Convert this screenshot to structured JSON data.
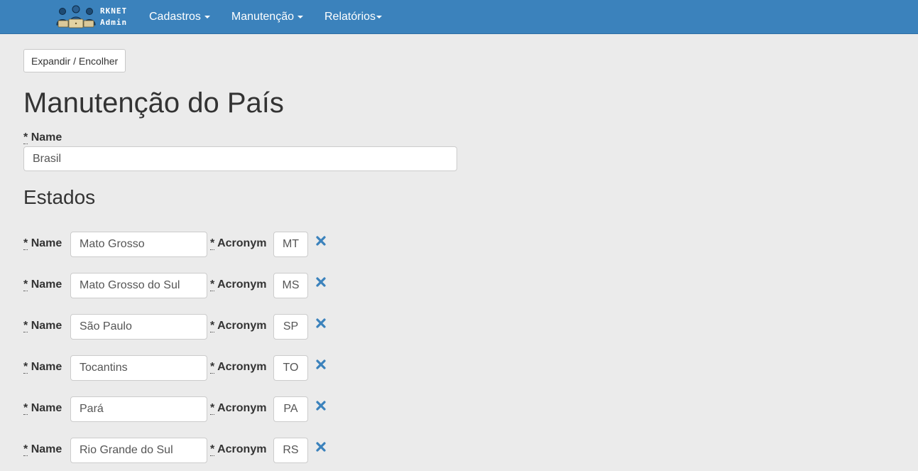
{
  "navbar": {
    "brand_line1": "RKNET",
    "brand_line2": "Admin",
    "brand_icon": "team-logo-icon",
    "menu": [
      {
        "label": "Cadastros"
      },
      {
        "label": "Manutenção"
      },
      {
        "label": "Relatórios"
      }
    ],
    "color": "#3b82bc"
  },
  "toolbar": {
    "toggle_label": "Expandir / Encolher"
  },
  "page": {
    "title": "Manutenção do País"
  },
  "country": {
    "required_mark": "*",
    "name_label": "Name",
    "name_value": "Brasil"
  },
  "states_section": {
    "title": "Estados",
    "required_mark": "*",
    "name_label": "Name",
    "acronym_label": "Acronym",
    "remove_icon": "close-icon",
    "remove_color": "#3b82bc",
    "rows": [
      {
        "name": "Mato Grosso",
        "acronym": "MT"
      },
      {
        "name": "Mato Grosso do Sul",
        "acronym": "MS"
      },
      {
        "name": "São Paulo",
        "acronym": "SP"
      },
      {
        "name": "Tocantins",
        "acronym": "TO"
      },
      {
        "name": "Pará",
        "acronym": "PA"
      },
      {
        "name": "Rio Grande do Sul",
        "acronym": "RS"
      }
    ]
  }
}
